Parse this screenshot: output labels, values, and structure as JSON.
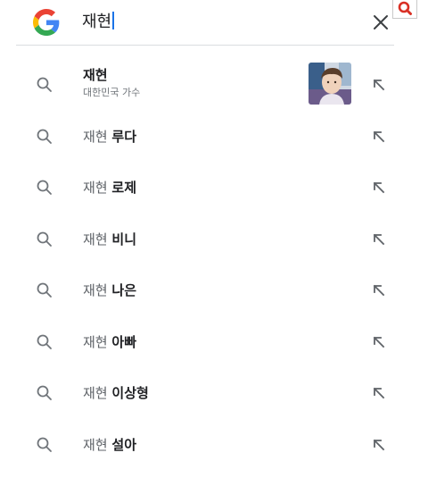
{
  "search": {
    "query": "재현",
    "logo": "google-g-icon",
    "clear_icon": "close-icon",
    "corner_icon": "search-icon"
  },
  "suggestions": [
    {
      "type": "entity",
      "title": "재현",
      "subtitle": "대한민국 가수",
      "thumbnail": "person-photo"
    },
    {
      "base": "재현",
      "completion": "루다"
    },
    {
      "base": "재현",
      "completion": "로제"
    },
    {
      "base": "재현",
      "completion": "비니"
    },
    {
      "base": "재현",
      "completion": "나은"
    },
    {
      "base": "재현",
      "completion": "아빠"
    },
    {
      "base": "재현",
      "completion": "이상형"
    },
    {
      "base": "재현",
      "completion": "설아"
    }
  ],
  "colors": {
    "google_blue": "#4285F4",
    "google_red": "#EA4335",
    "google_yellow": "#FBBC05",
    "google_green": "#34A853",
    "corner_red": "#d93025",
    "icon_gray": "#70757a"
  }
}
